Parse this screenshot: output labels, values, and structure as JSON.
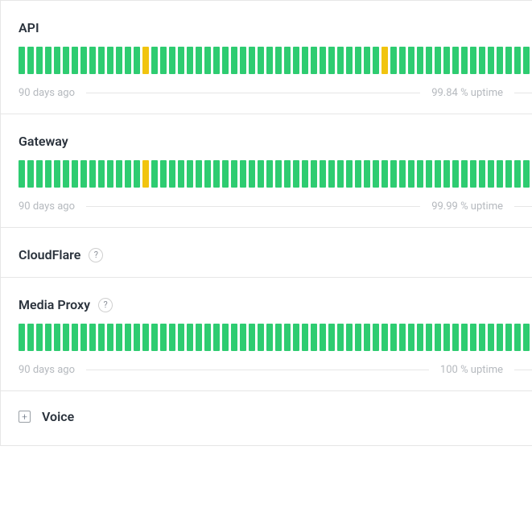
{
  "sections": [
    {
      "id": "api",
      "title": "API",
      "showHistory": true,
      "showHelp": false,
      "uptime": "99.84 % uptime",
      "daysAgo": "90 days ago",
      "bars": "ggggggggggggggyggggggggggggggggggggggggggyggggggggggggggggggggggg"
    },
    {
      "id": "gateway",
      "title": "Gateway",
      "showHistory": true,
      "showHelp": false,
      "uptime": "99.99 % uptime",
      "daysAgo": "90 days ago",
      "bars": "ggggggggggggggyggggggggggggggggggggggggggggggggggggggggggggggggggg"
    },
    {
      "id": "cloudflare",
      "title": "CloudFlare",
      "showHistory": false,
      "showHelp": true
    },
    {
      "id": "mediaproxy",
      "title": "Media Proxy",
      "showHistory": true,
      "showHelp": true,
      "uptime": "100 % uptime",
      "daysAgo": "90 days ago",
      "bars": "ggggggggggggggggggggggggggggggggggggggggggggggggggggggggggggggggg"
    }
  ],
  "voice": {
    "title": "Voice",
    "expandSymbol": "+"
  },
  "helpSymbol": "?"
}
